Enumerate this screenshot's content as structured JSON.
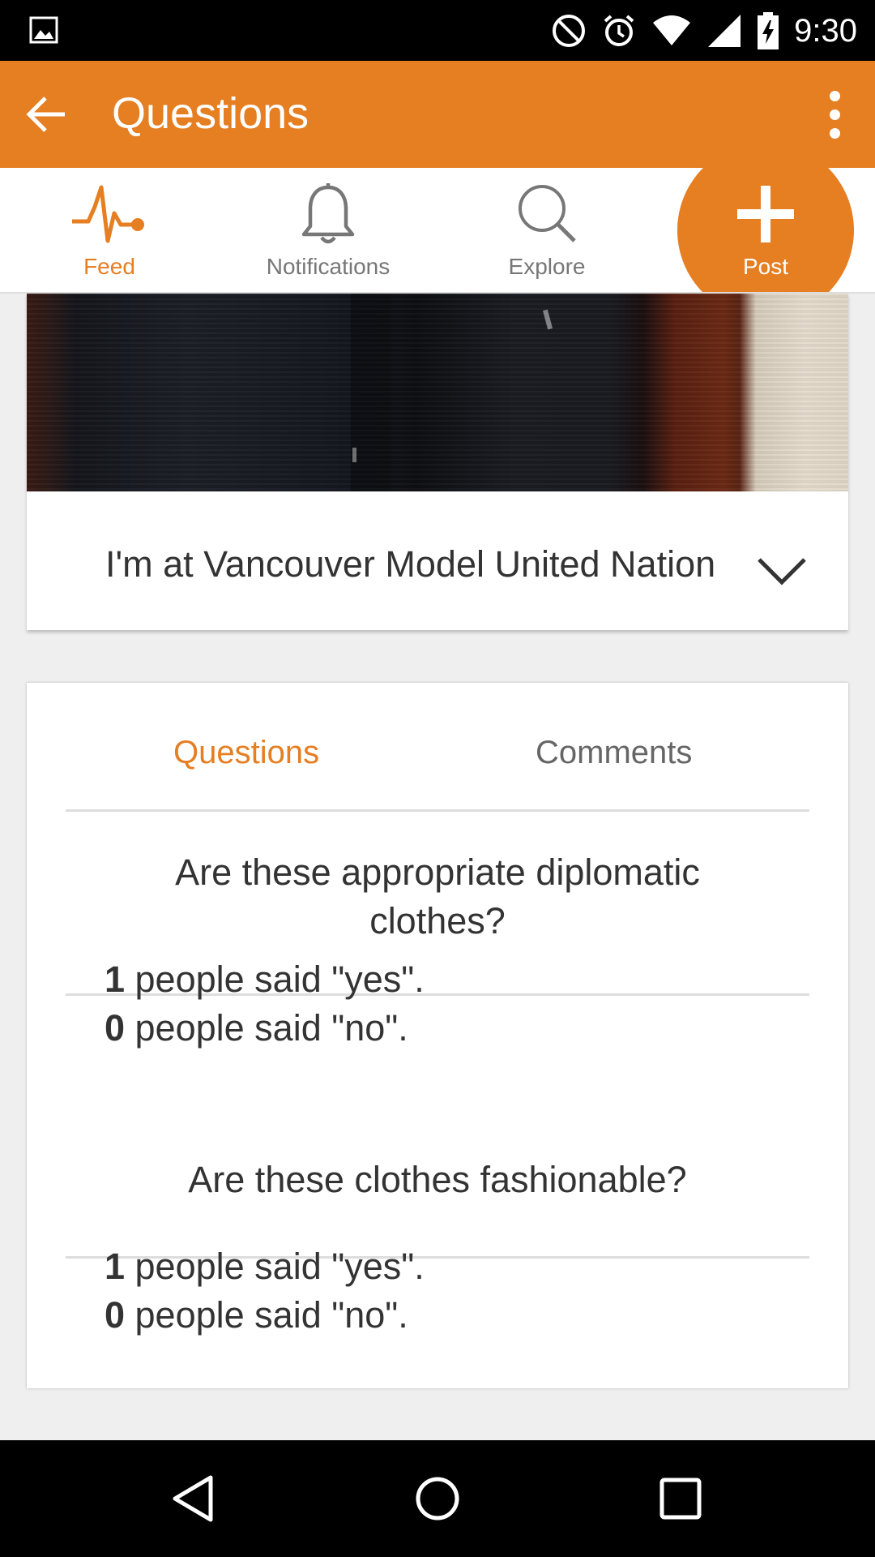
{
  "status_bar": {
    "time": "9:30",
    "icons": [
      "image-notification-icon",
      "do-not-disturb-icon",
      "alarm-icon",
      "wifi-icon",
      "cell-signal-icon",
      "battery-charging-icon"
    ]
  },
  "app_bar": {
    "title": "Questions",
    "background": "#e67e22"
  },
  "tabs": [
    {
      "label": "Feed",
      "icon": "pulse-icon",
      "active": true
    },
    {
      "label": "Notifications",
      "icon": "bell-icon",
      "active": false
    },
    {
      "label": "Explore",
      "icon": "search-icon",
      "active": false
    },
    {
      "label": "Post",
      "icon": "plus-icon",
      "active": false
    }
  ],
  "post": {
    "caption": "I'm at Vancouver Model United Nation"
  },
  "question_tabs": {
    "questions": "Questions",
    "comments": "Comments"
  },
  "questions": [
    {
      "line1": "Are these appropriate diplomatic",
      "line2": "clothes?",
      "yes_count": "1",
      "yes_text": " people said \"yes\".",
      "no_count": "0",
      "no_text": " people said \"no\"."
    },
    {
      "line1": "Are these clothes fashionable?",
      "yes_count": "1",
      "yes_text": " people said \"yes\".",
      "no_count": "0",
      "no_text": " people said \"no\"."
    }
  ],
  "colors": {
    "accent": "#e67e22",
    "text": "#333333",
    "muted": "#777777"
  }
}
